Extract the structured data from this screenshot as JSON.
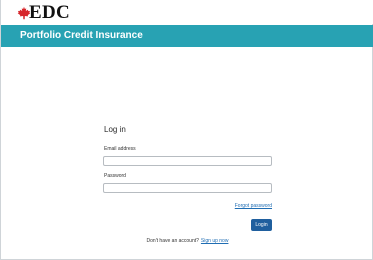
{
  "brand": {
    "logo_text": "EDC",
    "maple_leaf_color": "#d7262b"
  },
  "banner": {
    "title": "Portfolio Credit Insurance",
    "color": "#28a2b3"
  },
  "login": {
    "title": "Log in",
    "email_label": "Email address",
    "email_value": "",
    "password_label": "Password",
    "password_value": "",
    "forgot_password": "Forgot password",
    "login_button": "Login"
  },
  "signup": {
    "prompt": "Don't have an account?",
    "link": "Sign up now"
  }
}
